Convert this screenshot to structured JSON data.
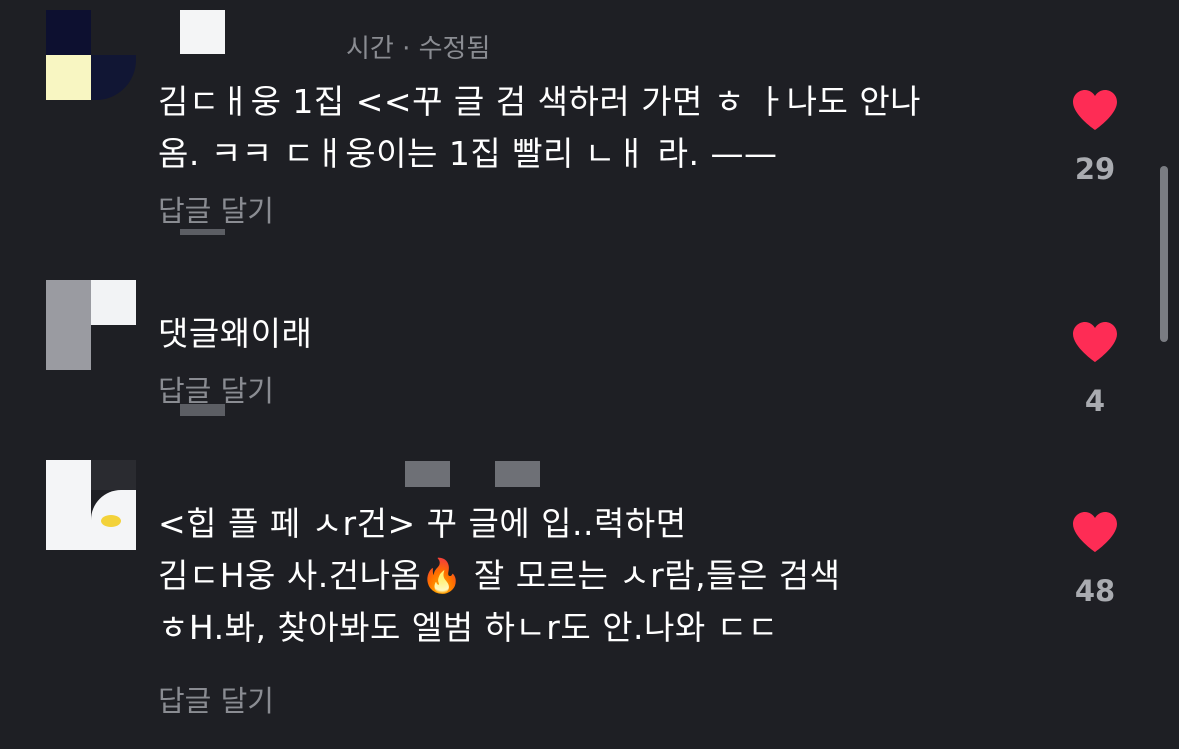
{
  "comments": [
    {
      "meta": "시간 · 수정됨",
      "lines": [
        "김ㄷㅐ웅 1집 <<꾸 글 검 색하러 가면 ㅎ ㅏ나도 안나",
        "옴. ㅋㅋ ㄷㅐ웅이는 1집 빨리 ㄴㅐ 라. ——"
      ],
      "reply_label": "답글 달기",
      "likes": "29"
    },
    {
      "meta": "",
      "lines": [
        "댓글왜이래"
      ],
      "reply_label": "답글 달기",
      "likes": "4"
    },
    {
      "meta": "",
      "lines": [
        "<힙 플 페 ㅅr건> 꾸 글에 입..력하면",
        "김ㄷH웅 사.건나옴🔥 잘 모르는 ㅅr람,들은 검색",
        "ㅎH.봐, 찾아봐도 엘범 하ㄴr도 안.나와 ㄷㄷ"
      ],
      "reply_label": "답글 달기",
      "likes": "48"
    }
  ],
  "colors": {
    "background": "#1e1f24",
    "text": "#ffffff",
    "muted": "#8a8c92",
    "heart": "#fe2c55",
    "count": "#a9abb0"
  },
  "icons": [
    "heart-icon"
  ]
}
